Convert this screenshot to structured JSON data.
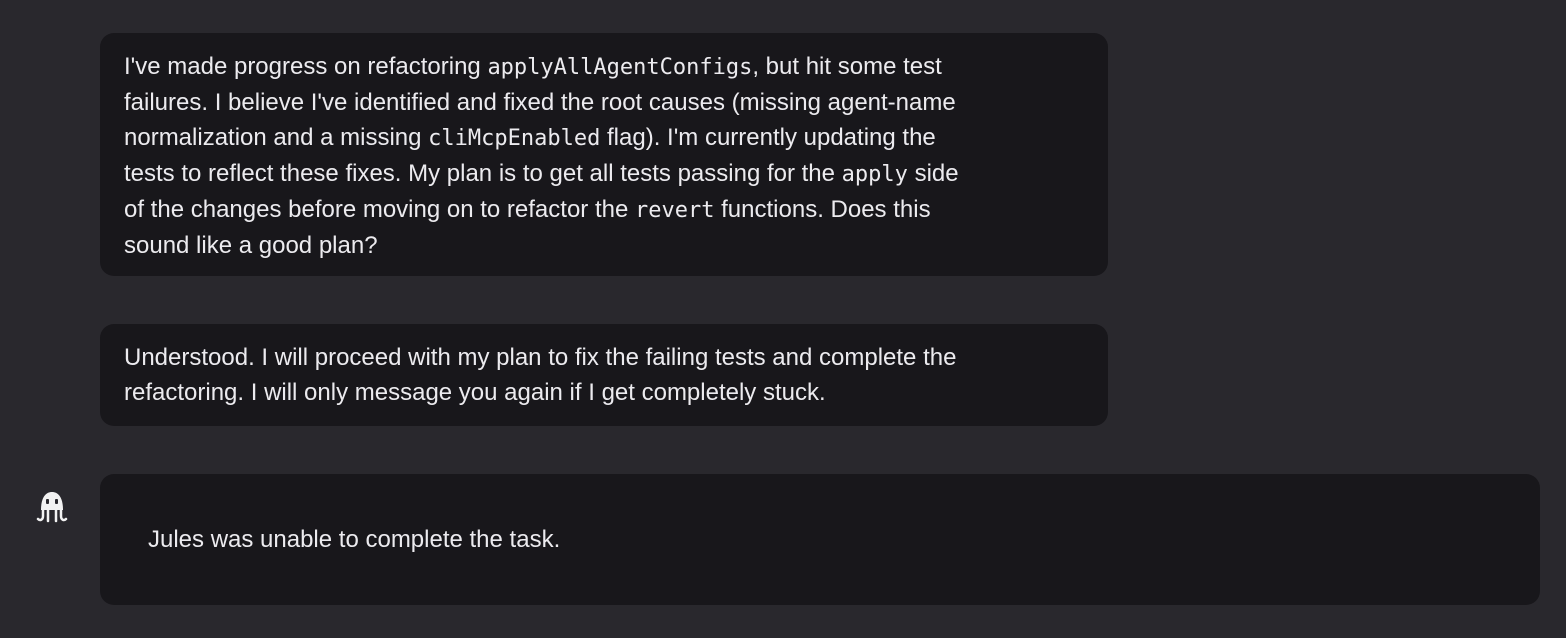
{
  "messages": [
    {
      "id": "progress-update",
      "lines": [
        [
          {
            "t": "I've made progress on refactoring "
          },
          {
            "c": "applyAllAgentConfigs"
          },
          {
            "t": ", but hit some test"
          }
        ],
        [
          {
            "t": "failures. I believe I've identified and fixed the root causes (missing agent-name"
          }
        ],
        [
          {
            "t": "normalization and a missing "
          },
          {
            "c": "cliMcpEnabled"
          },
          {
            "t": " flag). I'm currently updating the"
          }
        ],
        [
          {
            "t": "tests to reflect these fixes. My plan is to get all tests passing for the "
          },
          {
            "c": "apply"
          },
          {
            "t": " side"
          }
        ],
        [
          {
            "t": "of the changes before moving on to refactor the "
          },
          {
            "c": "revert"
          },
          {
            "t": " functions. Does this"
          }
        ],
        [
          {
            "t": "sound like a good plan?"
          }
        ]
      ]
    },
    {
      "id": "understood",
      "lines": [
        [
          {
            "t": "Understood. I will proceed with my plan to fix the failing tests and complete the"
          }
        ],
        [
          {
            "t": "refactoring. I will only message you again if I get completely stuck."
          }
        ]
      ]
    }
  ],
  "status": {
    "agent_icon": "octopus-icon",
    "text": "Jules was unable to complete the task."
  },
  "colors": {
    "background": "#29282d",
    "bubble": "#18171b",
    "text": "#ecebef"
  }
}
